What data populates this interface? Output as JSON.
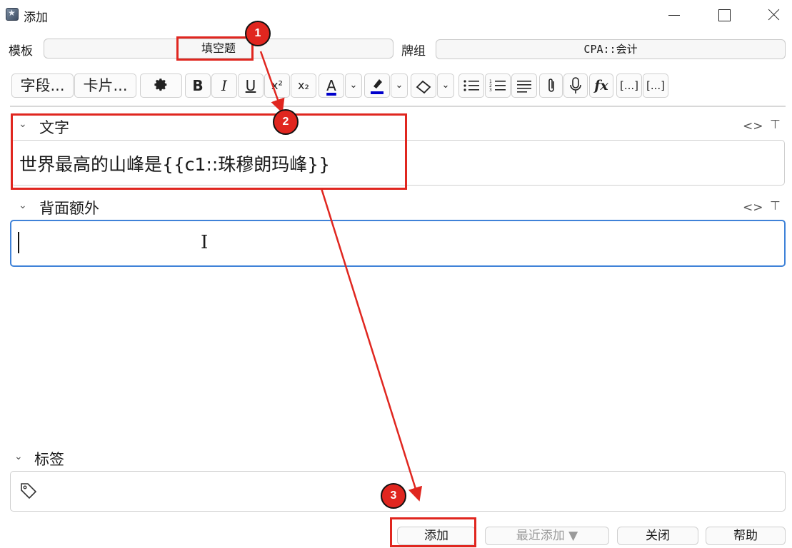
{
  "window": {
    "title": "添加"
  },
  "model_row": {
    "model_label": "模板",
    "model_value": "填空题",
    "deck_label": "牌组",
    "deck_value": "CPA::会计"
  },
  "toolbar": {
    "fields_label": "字段...",
    "cards_label": "卡片...",
    "bold": "B",
    "italic": "I",
    "underline": "U",
    "superscript": "x²",
    "subscript": "x₂",
    "text_color": "A",
    "formula": "fx",
    "cloze": "[...]",
    "cloze_same": "[...]"
  },
  "fields": [
    {
      "name": "文字",
      "value": "世界最高的山峰是{{c1::珠穆朗玛峰}}"
    },
    {
      "name": "背面额外",
      "value": ""
    }
  ],
  "tags": {
    "label": "标签"
  },
  "buttons": {
    "add": "添加",
    "history": "最近添加 ▼",
    "close": "关闭",
    "help": "帮助"
  },
  "annotations": [
    "1",
    "2",
    "3"
  ],
  "colors": {
    "annotation": "#e0261f",
    "focus": "#3f82d8",
    "color_bar": "#0000cc"
  }
}
